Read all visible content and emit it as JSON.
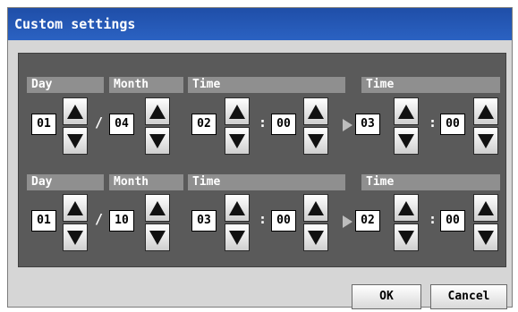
{
  "window": {
    "title": "Custom settings"
  },
  "rows": [
    {
      "day_label": "Day",
      "month_label": "Month",
      "time1_label": "Time",
      "time2_label": "Time",
      "day": "01",
      "month": "04",
      "start_hour": "02",
      "start_minute": "00",
      "end_hour": "03",
      "end_minute": "00",
      "date_separator": "/",
      "time_separator": ":"
    },
    {
      "day_label": "Day",
      "month_label": "Month",
      "time1_label": "Time",
      "time2_label": "Time",
      "day": "01",
      "month": "10",
      "start_hour": "03",
      "start_minute": "00",
      "end_hour": "02",
      "end_minute": "00",
      "date_separator": "/",
      "time_separator": ":"
    }
  ],
  "buttons": {
    "ok": "OK",
    "cancel": "Cancel"
  },
  "icons": {
    "up": "triangle-up-icon",
    "down": "triangle-down-icon",
    "range": "arrow-right-icon"
  },
  "colors": {
    "titlebar": "#2b5fbf",
    "panel": "#5a5a5a",
    "label_bg": "#8f8f8f"
  }
}
